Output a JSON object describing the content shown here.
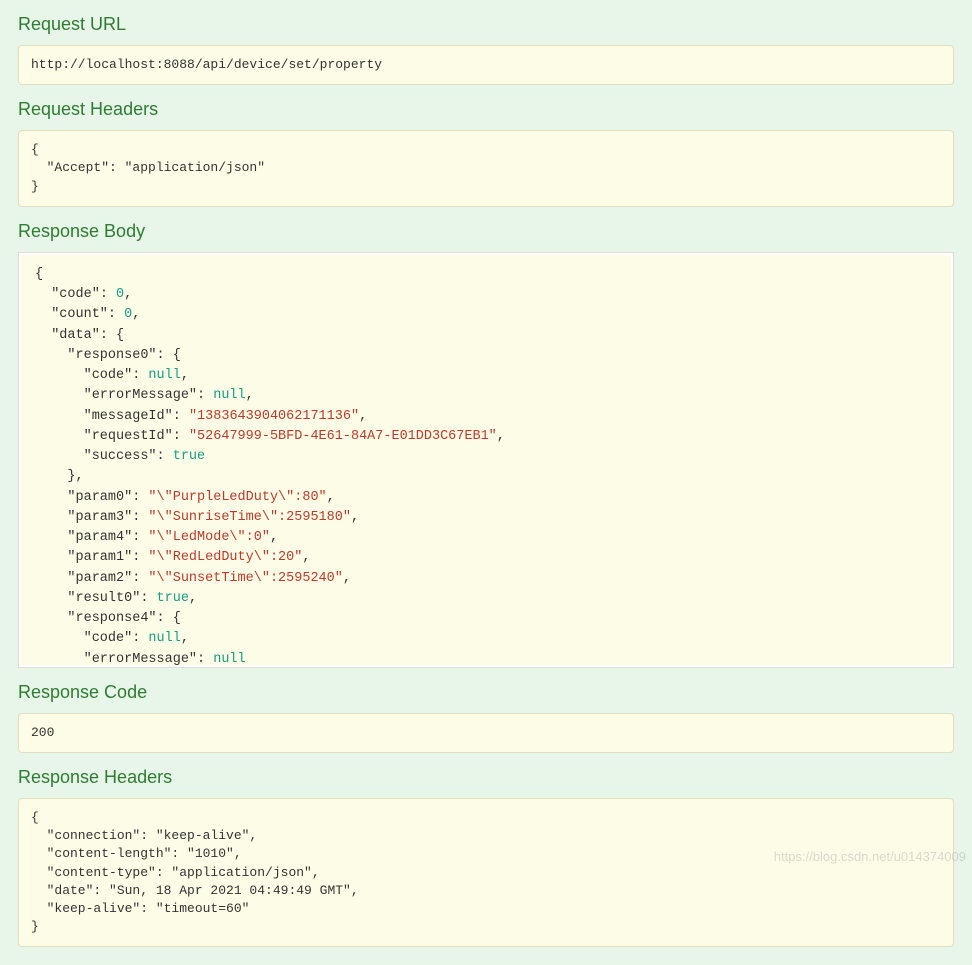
{
  "sections": {
    "request_url_title": "Request URL",
    "request_url_value": "http://localhost:8088/api/device/set/property",
    "request_headers_title": "Request Headers",
    "request_headers_value": "{\n  \"Accept\": \"application/json\"\n}",
    "response_body_title": "Response Body",
    "response_code_title": "Response Code",
    "response_code_value": "200",
    "response_headers_title": "Response Headers",
    "response_headers_value": "{\n  \"connection\": \"keep-alive\",\n  \"content-length\": \"1010\",\n  \"content-type\": \"application/json\",\n  \"date\": \"Sun, 18 Apr 2021 04:49:49 GMT\",\n  \"keep-alive\": \"timeout=60\"\n}"
  },
  "response_body": {
    "code": 0,
    "count": 0,
    "data": {
      "response0": {
        "code": null,
        "errorMessage": null,
        "messageId": "1383643904062171136",
        "requestId": "52647999-5BFD-4E61-84A7-E01DD3C67EB1",
        "success": true
      },
      "param0": "\\\"PurpleLedDuty\\\":80",
      "param3": "\\\"SunriseTime\\\":2595180",
      "param4": "\\\"LedMode\\\":0",
      "param1": "\\\"RedLedDuty\\\":20",
      "param2": "\\\"SunsetTime\\\":2595240",
      "result0": true,
      "response4": {
        "code": null,
        "errorMessage": null
      }
    }
  },
  "watermark": "https://blog.csdn.net/u014374009"
}
